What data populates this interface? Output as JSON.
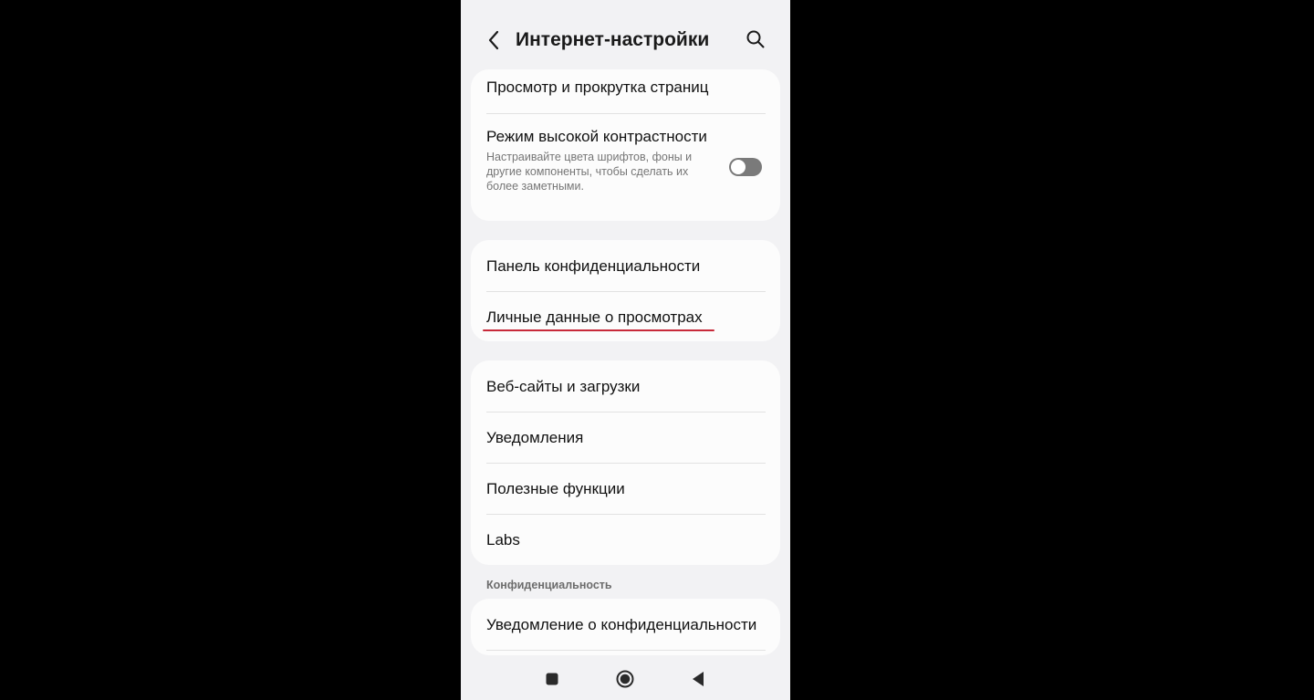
{
  "app": {
    "title": "Интернет-настройки",
    "back_icon": "back-arrow-icon",
    "search_icon": "search-icon"
  },
  "group1": {
    "item1": {
      "label": "Просмотр и прокрутка страниц"
    },
    "item2": {
      "label": "Режим высокой контрастности",
      "description": "Настраивайте цвета шрифтов, фоны и другие компоненты, чтобы сделать их более заметными.",
      "toggle_state": "off"
    }
  },
  "group2": {
    "item1": {
      "label": "Панель конфиденциальности"
    },
    "item2": {
      "label": "Личные данные о просмотрах"
    }
  },
  "group3": {
    "items": [
      {
        "label": "Веб-сайты и загрузки"
      },
      {
        "label": "Уведомления"
      },
      {
        "label": "Полезные функции"
      },
      {
        "label": "Labs"
      }
    ]
  },
  "section_privacy": {
    "header": "Конфиденциальность",
    "item1": {
      "label": "Уведомление о конфиденциальности"
    }
  },
  "navbar": {
    "recent_icon": "recent-apps-icon",
    "home_icon": "home-icon",
    "back_icon": "nav-back-icon"
  },
  "colors": {
    "background": "#f2f2f4",
    "card": "#fcfcfc",
    "accent_underline": "#c82a3a",
    "toggle_off": "#7a7a7a"
  }
}
